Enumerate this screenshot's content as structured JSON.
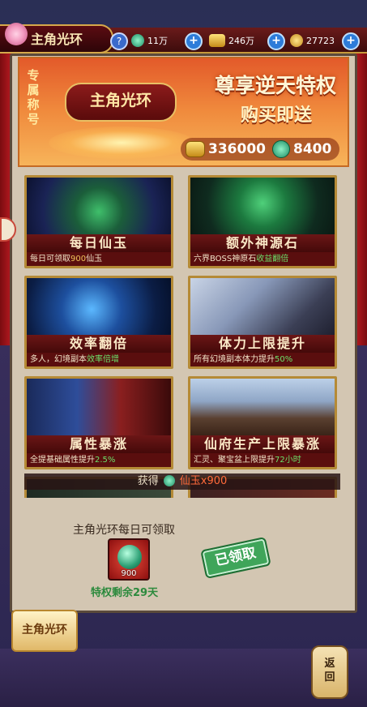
{
  "header": {
    "title": "主角光环",
    "resources": [
      {
        "icon": "jade-icon",
        "value": "11万"
      },
      {
        "icon": "gold-ingot-icon",
        "value": "246万"
      },
      {
        "icon": "coin-icon",
        "value": "27723"
      }
    ]
  },
  "banner": {
    "side_title": "专属称号",
    "emblem_text": "主角光环",
    "slogan_line1": "尊享逆天特权",
    "slogan_line2": "购买即送",
    "reward_gold": "336000",
    "reward_jade": "8400"
  },
  "cards": [
    {
      "name": "每日仙玉",
      "desc_pre": "每日可领取",
      "desc_hl": "900",
      "desc_post": "仙玉",
      "art": "treasure-chest"
    },
    {
      "name": "额外神源石",
      "desc_pre": "六界BOSS神原石",
      "desc_hl": "收益翻倍",
      "desc_post": "",
      "art": "green-crystal"
    },
    {
      "name": "效率翻倍",
      "desc_pre": "多人，幻境副本",
      "desc_hl": "效率倍增",
      "desc_post": "",
      "art": "blue-storm"
    },
    {
      "name": "体力上限提升",
      "desc_pre": "所有幻境副本体力提升",
      "desc_hl": "50%",
      "desc_post": "",
      "art": "warrior"
    },
    {
      "name": "属性暴涨",
      "desc_pre": "全提基础属性提升",
      "desc_hl": "2.5%",
      "desc_post": "",
      "art": "battle"
    },
    {
      "name": "仙府生产上限暴涨",
      "desc_pre": "汇灵、聚宝盆上限提升",
      "desc_hl": "72小时",
      "desc_post": "",
      "art": "palace"
    }
  ],
  "obtain": {
    "label": "获得",
    "item": "仙玉x900"
  },
  "daily": {
    "label": "主角光环每日可领取",
    "quantity": "900",
    "remaining": "特权剩余29天",
    "claimed_label": "已领取"
  },
  "bottom_tab": "主角光环",
  "back_button": "返回"
}
